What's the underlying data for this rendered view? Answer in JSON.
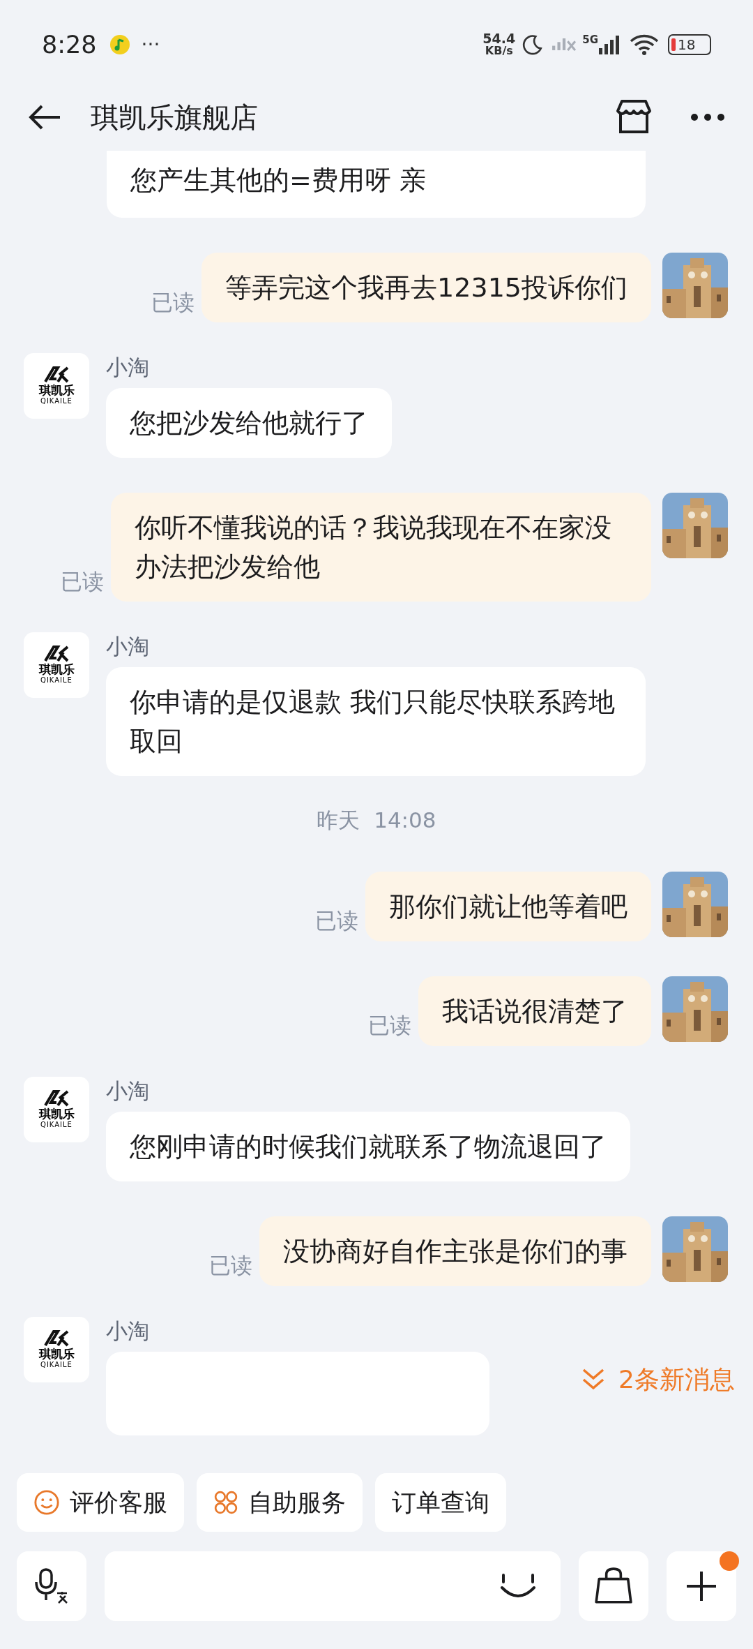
{
  "status_bar": {
    "time": "8:28",
    "more": "···",
    "net_speed_value": "54.4",
    "net_speed_unit": "KB/s",
    "sim2_label": "5G",
    "battery": "18"
  },
  "header": {
    "title": "琪凯乐旗舰店"
  },
  "messages": [
    {
      "kind": "received",
      "text": "您产生其他的=费用呀 亲",
      "continued": true
    },
    {
      "kind": "sent",
      "text": "等弄完这个我再去12315投诉你们",
      "status": "已读"
    },
    {
      "kind": "received",
      "sender": "小淘",
      "logo_text": "琪凯乐",
      "logo_subtext": "QIKAILE",
      "text": "您把沙发给他就行了"
    },
    {
      "kind": "sent",
      "text": "你听不懂我说的话？我说我现在不在家没办法把沙发给他",
      "status": "已读"
    },
    {
      "kind": "received",
      "sender": "小淘",
      "logo_text": "琪凯乐",
      "logo_subtext": "QIKAILE",
      "text": "你申请的是仅退款 我们只能尽快联系跨地取回"
    },
    {
      "kind": "time",
      "text": "昨天  14:08"
    },
    {
      "kind": "sent",
      "text": "那你们就让他等着吧",
      "status": "已读"
    },
    {
      "kind": "sent",
      "text": "我话说很清楚了",
      "status": "已读"
    },
    {
      "kind": "received",
      "sender": "小淘",
      "logo_text": "琪凯乐",
      "logo_subtext": "QIKAILE",
      "text": "您刚申请的时候我们就联系了物流退回了"
    },
    {
      "kind": "sent",
      "text": "没协商好自作主张是你们的事",
      "status": "已读"
    },
    {
      "kind": "received",
      "sender": "小淘",
      "logo_text": "琪凯乐",
      "logo_subtext": "QIKAILE"
    }
  ],
  "new_messages": "2条新消息",
  "quick_actions": [
    {
      "kind": "rate",
      "label": "评价客服"
    },
    {
      "kind": "self_service",
      "label": "自助服务"
    },
    {
      "kind": "plain",
      "label": "订单查询"
    }
  ],
  "input_bar": {
    "plus_badge": true
  }
}
